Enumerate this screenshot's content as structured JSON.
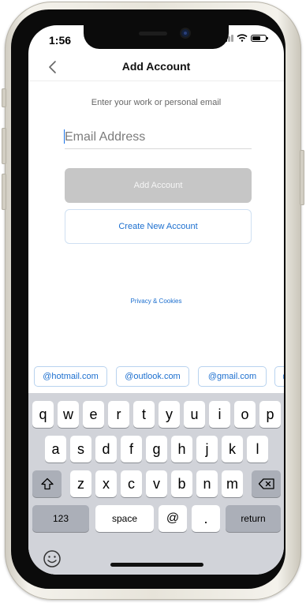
{
  "status_bar": {
    "time": "1:56",
    "battery_level": 0.6
  },
  "nav": {
    "title": "Add Account",
    "back_icon": "chevron-left-icon"
  },
  "form": {
    "prompt": "Enter your work or personal email",
    "email_placeholder": "Email Address",
    "email_value": "",
    "add_button_label": "Add Account",
    "create_button_label": "Create New Account",
    "privacy_link": "Privacy & Cookies"
  },
  "suggestions": [
    "@hotmail.com",
    "@outlook.com",
    "@gmail.com",
    "@"
  ],
  "keyboard": {
    "row1": [
      "q",
      "w",
      "e",
      "r",
      "t",
      "y",
      "u",
      "i",
      "o",
      "p"
    ],
    "row2": [
      "a",
      "s",
      "d",
      "f",
      "g",
      "h",
      "j",
      "k",
      "l"
    ],
    "row3": [
      "z",
      "x",
      "c",
      "v",
      "b",
      "n",
      "m"
    ],
    "shift_icon": "shift-icon",
    "delete_icon": "backspace-icon",
    "numbers_label": "123",
    "space_label": "space",
    "at_label": "@",
    "dot_label": ".",
    "return_label": "return",
    "emoji_icon": "emoji-icon"
  },
  "colors": {
    "accent": "#1c6fcf",
    "disabled_button": "#c6c6c6",
    "keyboard_bg": "#d1d3d9"
  }
}
